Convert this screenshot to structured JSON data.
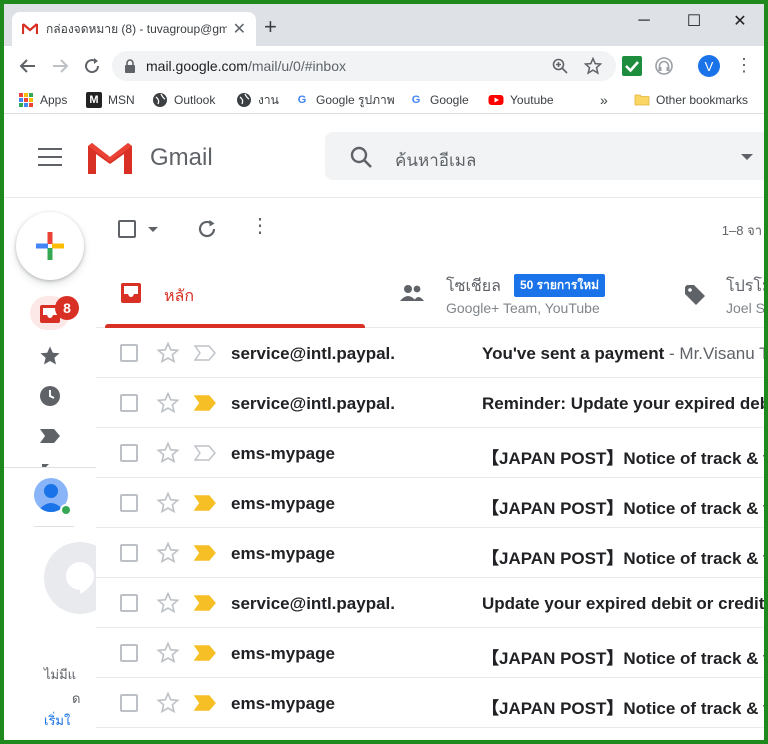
{
  "browser": {
    "tab_title": "กล่องจดหมาย (8) - tuvagroup@gm",
    "url_main": "mail.google.com",
    "url_path": "/mail/u/0/#inbox",
    "profile_initial": "V"
  },
  "bookmarks": {
    "items": [
      "Apps",
      "MSN",
      "Outlook",
      "งาน",
      "Google รูปภาพ",
      "Google",
      "Youtube"
    ],
    "overflow": "»",
    "other": "Other bookmarks"
  },
  "gmail": {
    "brand": "Gmail",
    "search_placeholder": "ค้นหาอีเมล",
    "inbox_count": "8",
    "pager": "1–8 จา"
  },
  "categories": {
    "primary": "หลัก",
    "social": "โซเชียล",
    "social_badge": "50 รายการใหม่",
    "social_sub": "Google+ Team, YouTube",
    "promo": "โปรโม",
    "promo_sub": "Joel S"
  },
  "hangouts": {
    "line1": "ไม่มีแ",
    "line2": "ด",
    "link": "เริ่มใ"
  },
  "emails": [
    {
      "sender": "service@intl.paypal.",
      "subject": "You've sent a payment",
      "snippet": " - Mr.Visanu T",
      "important": false
    },
    {
      "sender": "service@intl.paypal.",
      "subject": "Reminder: Update your expired deb",
      "snippet": "",
      "important": true
    },
    {
      "sender": "ems-mypage",
      "subject": "【JAPAN POST】Notice of track & t",
      "snippet": "",
      "important": false
    },
    {
      "sender": "ems-mypage",
      "subject": "【JAPAN POST】Notice of track & t",
      "snippet": "",
      "important": true
    },
    {
      "sender": "ems-mypage",
      "subject": "【JAPAN POST】Notice of track & t",
      "snippet": "",
      "important": true
    },
    {
      "sender": "service@intl.paypal.",
      "subject": "Update your expired debit or credit",
      "snippet": "",
      "important": true
    },
    {
      "sender": "ems-mypage",
      "subject": "【JAPAN POST】Notice of track & t",
      "snippet": "",
      "important": true
    },
    {
      "sender": "ems-mypage",
      "subject": "【JAPAN POST】Notice of track & t",
      "snippet": "",
      "important": true
    }
  ]
}
